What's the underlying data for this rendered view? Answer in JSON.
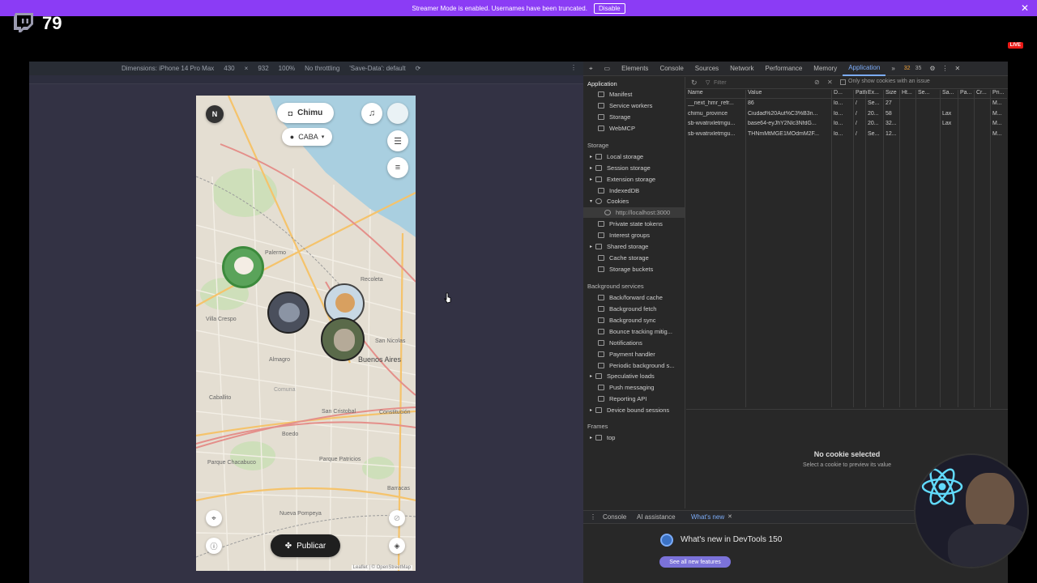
{
  "stream": {
    "banner_text": "Streamer Mode is enabled. Usernames have been truncated.",
    "disable_label": "Disable",
    "viewer_count": "79",
    "live_label": "LIVE"
  },
  "device_toolbar": {
    "dimensions_label": "Dimensions: iPhone 14 Pro Max",
    "width": "430",
    "times": "×",
    "height": "932",
    "zoom": "100%",
    "throttling": "No throttling",
    "save_data": "'Save-Data': default"
  },
  "app": {
    "avatar_letter": "N",
    "user_pill": "Chimu",
    "location_pill": "CABA",
    "publish_button": "Publicar",
    "attribution": "Leaflet | © OpenStreetMap",
    "map_labels": {
      "palermo": "Palermo",
      "recoleta": "Recoleta",
      "villa_crespo": "Villa Crespo",
      "almagro": "Almagro",
      "san_nicolas": "San Nicolas",
      "buenos_aires": "Buenos Aires",
      "caballito": "Caballito",
      "comuna": "Comuna",
      "san_cristobal": "San Cristobal",
      "constitucion": "Constitución",
      "boedo": "Boedo",
      "parque_chacabuco": "Parque Chacabuco",
      "parque_patricios": "Parque Patricios",
      "barracas": "Barracas",
      "nueva_pompeya": "Nueva Pompeya"
    }
  },
  "devtools": {
    "tabs": [
      "Elements",
      "Console",
      "Sources",
      "Network",
      "Performance",
      "Memory",
      "Application"
    ],
    "active_tab": "Application",
    "badges": {
      "warnings": "32",
      "issues": "35"
    },
    "sidebar": {
      "application_head": "Application",
      "application_items": [
        "Manifest",
        "Service workers",
        "Storage",
        "WebMCP"
      ],
      "storage_head": "Storage",
      "storage_items": [
        "Local storage",
        "Session storage",
        "Extension storage",
        "IndexedDB",
        "Cookies",
        "http://localhost:3000",
        "Private state tokens",
        "Interest groups",
        "Shared storage",
        "Cache storage",
        "Storage buckets"
      ],
      "background_head": "Background services",
      "background_items": [
        "Back/forward cache",
        "Background fetch",
        "Background sync",
        "Bounce tracking mitig...",
        "Notifications",
        "Payment handler",
        "Periodic background s...",
        "Speculative loads",
        "Push messaging",
        "Reporting API",
        "Device bound sessions"
      ],
      "frames_head": "Frames",
      "frames_items": [
        "top"
      ]
    },
    "cookie_toolbar": {
      "filter_placeholder": "Filter",
      "only_issue_label": "Only show cookies with an issue"
    },
    "cookie_table": {
      "headers": [
        "Name",
        "Value",
        "D...",
        "Path",
        "Ex...",
        "Size",
        "Ht...",
        "Se...",
        "Sa...",
        "Pa...",
        "Cr...",
        "Pri..."
      ],
      "rows": [
        [
          "__next_hmr_refr...",
          "86",
          "lo...",
          "/",
          "Se...",
          "27",
          "",
          "",
          "",
          "",
          "",
          "M..."
        ],
        [
          "chimu_province",
          "Ciudad%20Aut%C3%B3n...",
          "lo...",
          "/",
          "20...",
          "58",
          "",
          "",
          "Lax",
          "",
          "",
          "M..."
        ],
        [
          "sb-wvatnxletmgu...",
          "base64-eyJhY2Nlc3NfdG...",
          "lo...",
          "/",
          "20...",
          "32...",
          "",
          "",
          "Lax",
          "",
          "",
          "M..."
        ],
        [
          "sb-wvatnxletmgu...",
          "THNmMtMGE1MOdmM2F...",
          "lo...",
          "/",
          "Se...",
          "12...",
          "",
          "",
          "",
          "",
          "",
          "M..."
        ]
      ]
    },
    "preview": {
      "title": "No cookie selected",
      "subtitle": "Select a cookie to preview its value"
    },
    "drawer": {
      "tabs": [
        "Console",
        "AI assistance",
        "What's new"
      ],
      "whats_new_title": "What's new in DevTools 150",
      "see_all_label": "See all new features"
    }
  },
  "colors": {
    "twitch_purple": "#8b3cf5",
    "devtools_accent": "#7cacf8",
    "live_red": "#e91916"
  }
}
